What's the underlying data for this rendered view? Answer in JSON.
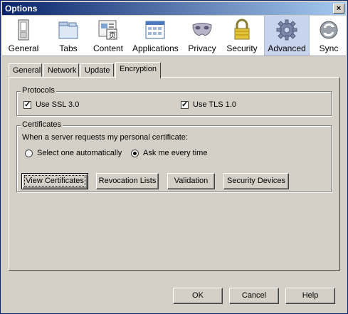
{
  "window": {
    "title": "Options",
    "close_glyph": "×"
  },
  "toolbar": {
    "items": [
      {
        "label": "General",
        "icon": "general-icon"
      },
      {
        "label": "Tabs",
        "icon": "tabs-icon"
      },
      {
        "label": "Content",
        "icon": "content-icon"
      },
      {
        "label": "Applications",
        "icon": "applications-icon"
      },
      {
        "label": "Privacy",
        "icon": "privacy-mask-icon"
      },
      {
        "label": "Security",
        "icon": "lock-icon"
      },
      {
        "label": "Advanced",
        "icon": "gear-icon",
        "selected": true
      },
      {
        "label": "Sync",
        "icon": "sync-icon"
      }
    ]
  },
  "tabs": [
    {
      "label": "General"
    },
    {
      "label": "Network"
    },
    {
      "label": "Update"
    },
    {
      "label": "Encryption",
      "active": true
    }
  ],
  "protocols": {
    "legend": "Protocols",
    "ssl_label": "Use SSL 3.0",
    "ssl_checked": true,
    "tls_label": "Use TLS 1.0",
    "tls_checked": true,
    "check_glyph": "✓"
  },
  "certificates": {
    "legend": "Certificates",
    "prompt": "When a server requests my personal certificate:",
    "option_auto": "Select one automatically",
    "option_ask": "Ask me every time",
    "selected": "ask",
    "buttons": {
      "view": "View Certificates",
      "revocation": "Revocation Lists",
      "validation": "Validation",
      "devices": "Security Devices"
    }
  },
  "footer": {
    "ok": "OK",
    "cancel": "Cancel",
    "help": "Help"
  },
  "colors": {
    "titlebar_start": "#0a246a",
    "titlebar_end": "#a6caf0",
    "face": "#d4d0c8",
    "selected_tool": "#c8d4ec"
  }
}
